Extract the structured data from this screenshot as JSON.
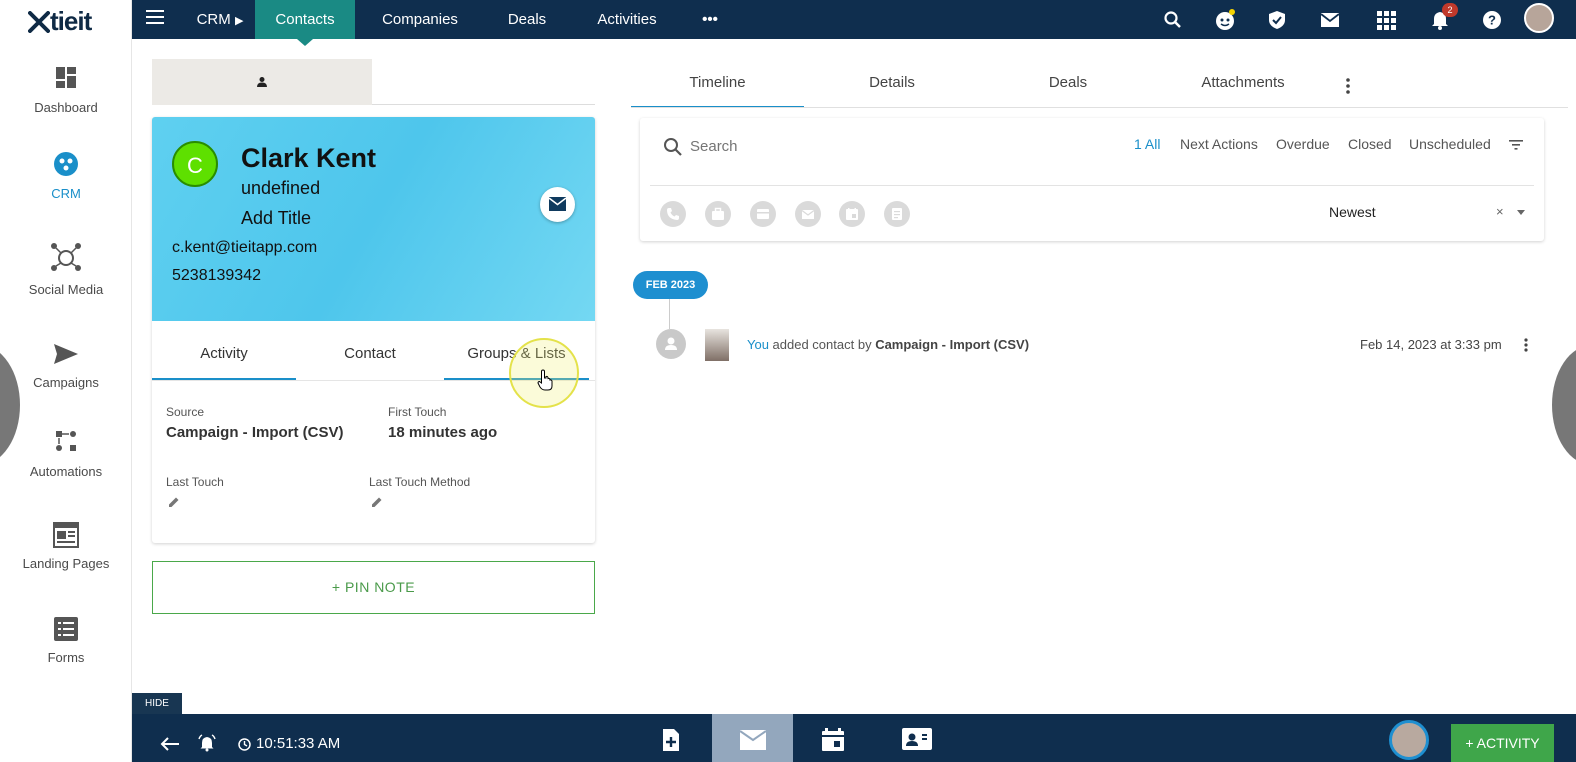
{
  "app": {
    "logo": "tieit",
    "sidebar": {
      "items": [
        {
          "label": "Dashboard",
          "icon": "dashboard-icon"
        },
        {
          "label": "CRM",
          "icon": "crm-icon",
          "active": true
        },
        {
          "label": "Social Media",
          "icon": "social-media-icon"
        },
        {
          "label": "Campaigns",
          "icon": "send-icon"
        },
        {
          "label": "Automations",
          "icon": "automations-icon"
        },
        {
          "label": "Landing Pages",
          "icon": "landing-page-icon"
        },
        {
          "label": "Forms",
          "icon": "forms-icon"
        }
      ]
    },
    "topbar": {
      "breadcrumb": "CRM",
      "tabs": [
        "Contacts",
        "Companies",
        "Deals",
        "Activities"
      ],
      "more": "•••",
      "notification_count": "2"
    }
  },
  "contact": {
    "initial": "C",
    "name": "Clark Kent",
    "company": "undefined",
    "title": "Add Title",
    "email": "c.kent@tieitapp.com",
    "phone": "5238139342",
    "tabs": [
      "Activity",
      "Contact",
      "Groups & Lists"
    ],
    "fields": {
      "source_label": "Source",
      "source_value": "Campaign - Import (CSV)",
      "first_touch_label": "First Touch",
      "first_touch_value": "18 minutes ago",
      "last_touch_label": "Last Touch",
      "last_touch_method_label": "Last Touch Method"
    },
    "pin_note": "+  PIN NOTE"
  },
  "timeline_panel": {
    "tabs": [
      "Timeline",
      "Details",
      "Deals",
      "Attachments"
    ],
    "search_placeholder": "Search",
    "filters": [
      "1 All",
      "Next Actions",
      "Overdue",
      "Closed",
      "Unscheduled"
    ],
    "activity_types": [
      "phone-icon",
      "briefcase-icon",
      "card-icon",
      "email-icon",
      "calendar-icon",
      "note-icon"
    ],
    "sort": "Newest",
    "sort_clear": "×",
    "month": "FEB 2023",
    "entry": {
      "actor": "You",
      "text": " added contact by ",
      "source": "Campaign - Import (CSV)",
      "date": "Feb 14, 2023 at 3:33 pm"
    }
  },
  "bottombar": {
    "hide": "HIDE",
    "time": "10:51:33 AM",
    "activity_button": "+  ACTIVITY"
  },
  "colors": {
    "nav_bg": "#0f2e4e",
    "active_tab": "#1a8a84",
    "accent": "#1a8fc9",
    "hero": "#5fd0f0",
    "avatar": "#5ee000",
    "success": "#3fa64a"
  }
}
